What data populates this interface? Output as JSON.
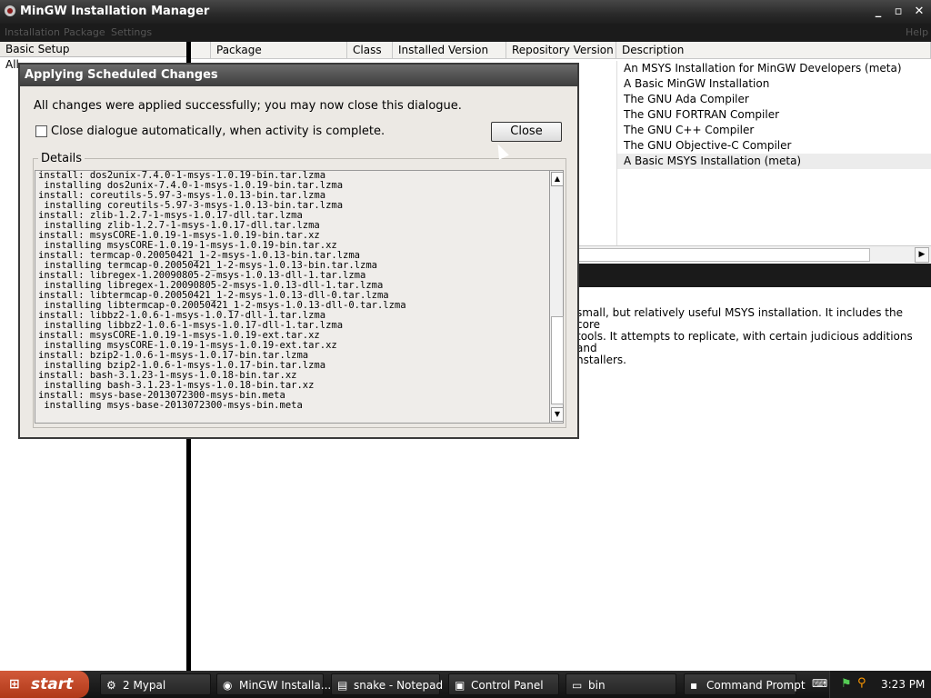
{
  "window": {
    "title": "MinGW Installation Manager",
    "minimize": "_",
    "maximize": "▫",
    "close": "✕"
  },
  "menu": [
    "Installation",
    "Package",
    "Settings",
    "Help"
  ],
  "left_panel": {
    "header": "Basic Setup",
    "item": "All"
  },
  "table": {
    "columns": [
      "Package",
      "Class",
      "Installed Version",
      "Repository Version",
      "Description"
    ],
    "descriptions": [
      "An MSYS Installation for MinGW Developers (meta)",
      "A Basic MinGW Installation",
      "The GNU Ada Compiler",
      "The GNU FORTRAN Compiler",
      "The GNU C++ Compiler",
      "The GNU Objective-C Compiler",
      "A Basic MSYS Installation (meta)"
    ]
  },
  "detail_text": [
    "small, but relatively useful MSYS installation. It includes the core",
    "tools. It attempts to replicate, with certain judicious additions and",
    "nstallers."
  ],
  "dialog": {
    "title": "Applying Scheduled Changes",
    "message": "All changes were applied successfully; you may now close this dialogue.",
    "checkbox_label": "Close dialogue automatically, when activity is complete.",
    "checkbox_checked": false,
    "close_button": "Close",
    "details_label": "Details",
    "log": [
      "install: dos2unix-7.4.0-1-msys-1.0.19-bin.tar.lzma",
      " installing dos2unix-7.4.0-1-msys-1.0.19-bin.tar.lzma",
      "install: coreutils-5.97-3-msys-1.0.13-bin.tar.lzma",
      " installing coreutils-5.97-3-msys-1.0.13-bin.tar.lzma",
      "install: zlib-1.2.7-1-msys-1.0.17-dll.tar.lzma",
      " installing zlib-1.2.7-1-msys-1.0.17-dll.tar.lzma",
      "install: msysCORE-1.0.19-1-msys-1.0.19-bin.tar.xz",
      " installing msysCORE-1.0.19-1-msys-1.0.19-bin.tar.xz",
      "install: termcap-0.20050421_1-2-msys-1.0.13-bin.tar.lzma",
      " installing termcap-0.20050421_1-2-msys-1.0.13-bin.tar.lzma",
      "install: libregex-1.20090805-2-msys-1.0.13-dll-1.tar.lzma",
      " installing libregex-1.20090805-2-msys-1.0.13-dll-1.tar.lzma",
      "install: libtermcap-0.20050421_1-2-msys-1.0.13-dll-0.tar.lzma",
      " installing libtermcap-0.20050421_1-2-msys-1.0.13-dll-0.tar.lzma",
      "install: libbz2-1.0.6-1-msys-1.0.17-dll-1.tar.lzma",
      " installing libbz2-1.0.6-1-msys-1.0.17-dll-1.tar.lzma",
      "install: msysCORE-1.0.19-1-msys-1.0.19-ext.tar.xz",
      " installing msysCORE-1.0.19-1-msys-1.0.19-ext.tar.xz",
      "install: bzip2-1.0.6-1-msys-1.0.17-bin.tar.lzma",
      " installing bzip2-1.0.6-1-msys-1.0.17-bin.tar.lzma",
      "install: bash-3.1.23-1-msys-1.0.18-bin.tar.xz",
      " installing bash-3.1.23-1-msys-1.0.18-bin.tar.xz",
      "install: msys-base-2013072300-msys-bin.meta",
      " installing msys-base-2013072300-msys-bin.meta"
    ]
  },
  "taskbar": {
    "start": "start",
    "tasks": [
      {
        "icon": "folder-tools-icon",
        "label": "2 Mypal"
      },
      {
        "icon": "mingw-icon",
        "label": "MinGW Installa..."
      },
      {
        "icon": "notepad-icon",
        "label": "snake - Notepad"
      },
      {
        "icon": "control-panel-icon",
        "label": "Control Panel"
      },
      {
        "icon": "folder-icon",
        "label": "bin"
      },
      {
        "icon": "command-prompt-icon",
        "label": "Command Prompt"
      }
    ],
    "clock": "3:23 PM"
  }
}
